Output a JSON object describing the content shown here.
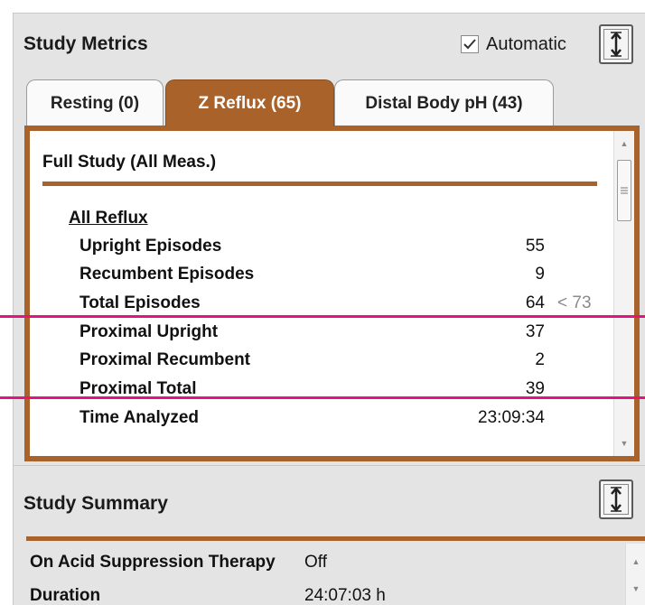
{
  "metrics": {
    "title": "Study Metrics",
    "automatic_label": "Automatic",
    "automatic_checked": true,
    "expand_icon": "expand-vertical-icon",
    "tabs": [
      {
        "label": "Resting (0)",
        "active": false
      },
      {
        "label": "Z Reflux (65)",
        "active": true
      },
      {
        "label": "Distal Body pH (43)",
        "active": false
      }
    ],
    "section_title": "Full Study (All Meas.)",
    "group_title": "All Reflux",
    "rows": [
      {
        "label": "Upright Episodes",
        "value": "55",
        "ref": ""
      },
      {
        "label": "Recumbent Episodes",
        "value": "9",
        "ref": ""
      },
      {
        "label": "Total Episodes",
        "value": "64",
        "ref": "< 73"
      },
      {
        "label": "Proximal Upright",
        "value": "37",
        "ref": ""
      },
      {
        "label": "Proximal Recumbent",
        "value": "2",
        "ref": ""
      },
      {
        "label": "Proximal Total",
        "value": "39",
        "ref": ""
      },
      {
        "label": "Time Analyzed",
        "value": "23:09:34",
        "ref": ""
      }
    ]
  },
  "summary": {
    "title": "Study Summary",
    "expand_icon": "expand-vertical-icon",
    "rows": [
      {
        "label": "On Acid Suppression Therapy",
        "value": "Off"
      },
      {
        "label": "Duration",
        "value": "24:07:03 h"
      }
    ]
  },
  "colors": {
    "accent": "#a9622a",
    "highlight_line": "#e6127e",
    "panel_bg": "#e4e4e4"
  }
}
